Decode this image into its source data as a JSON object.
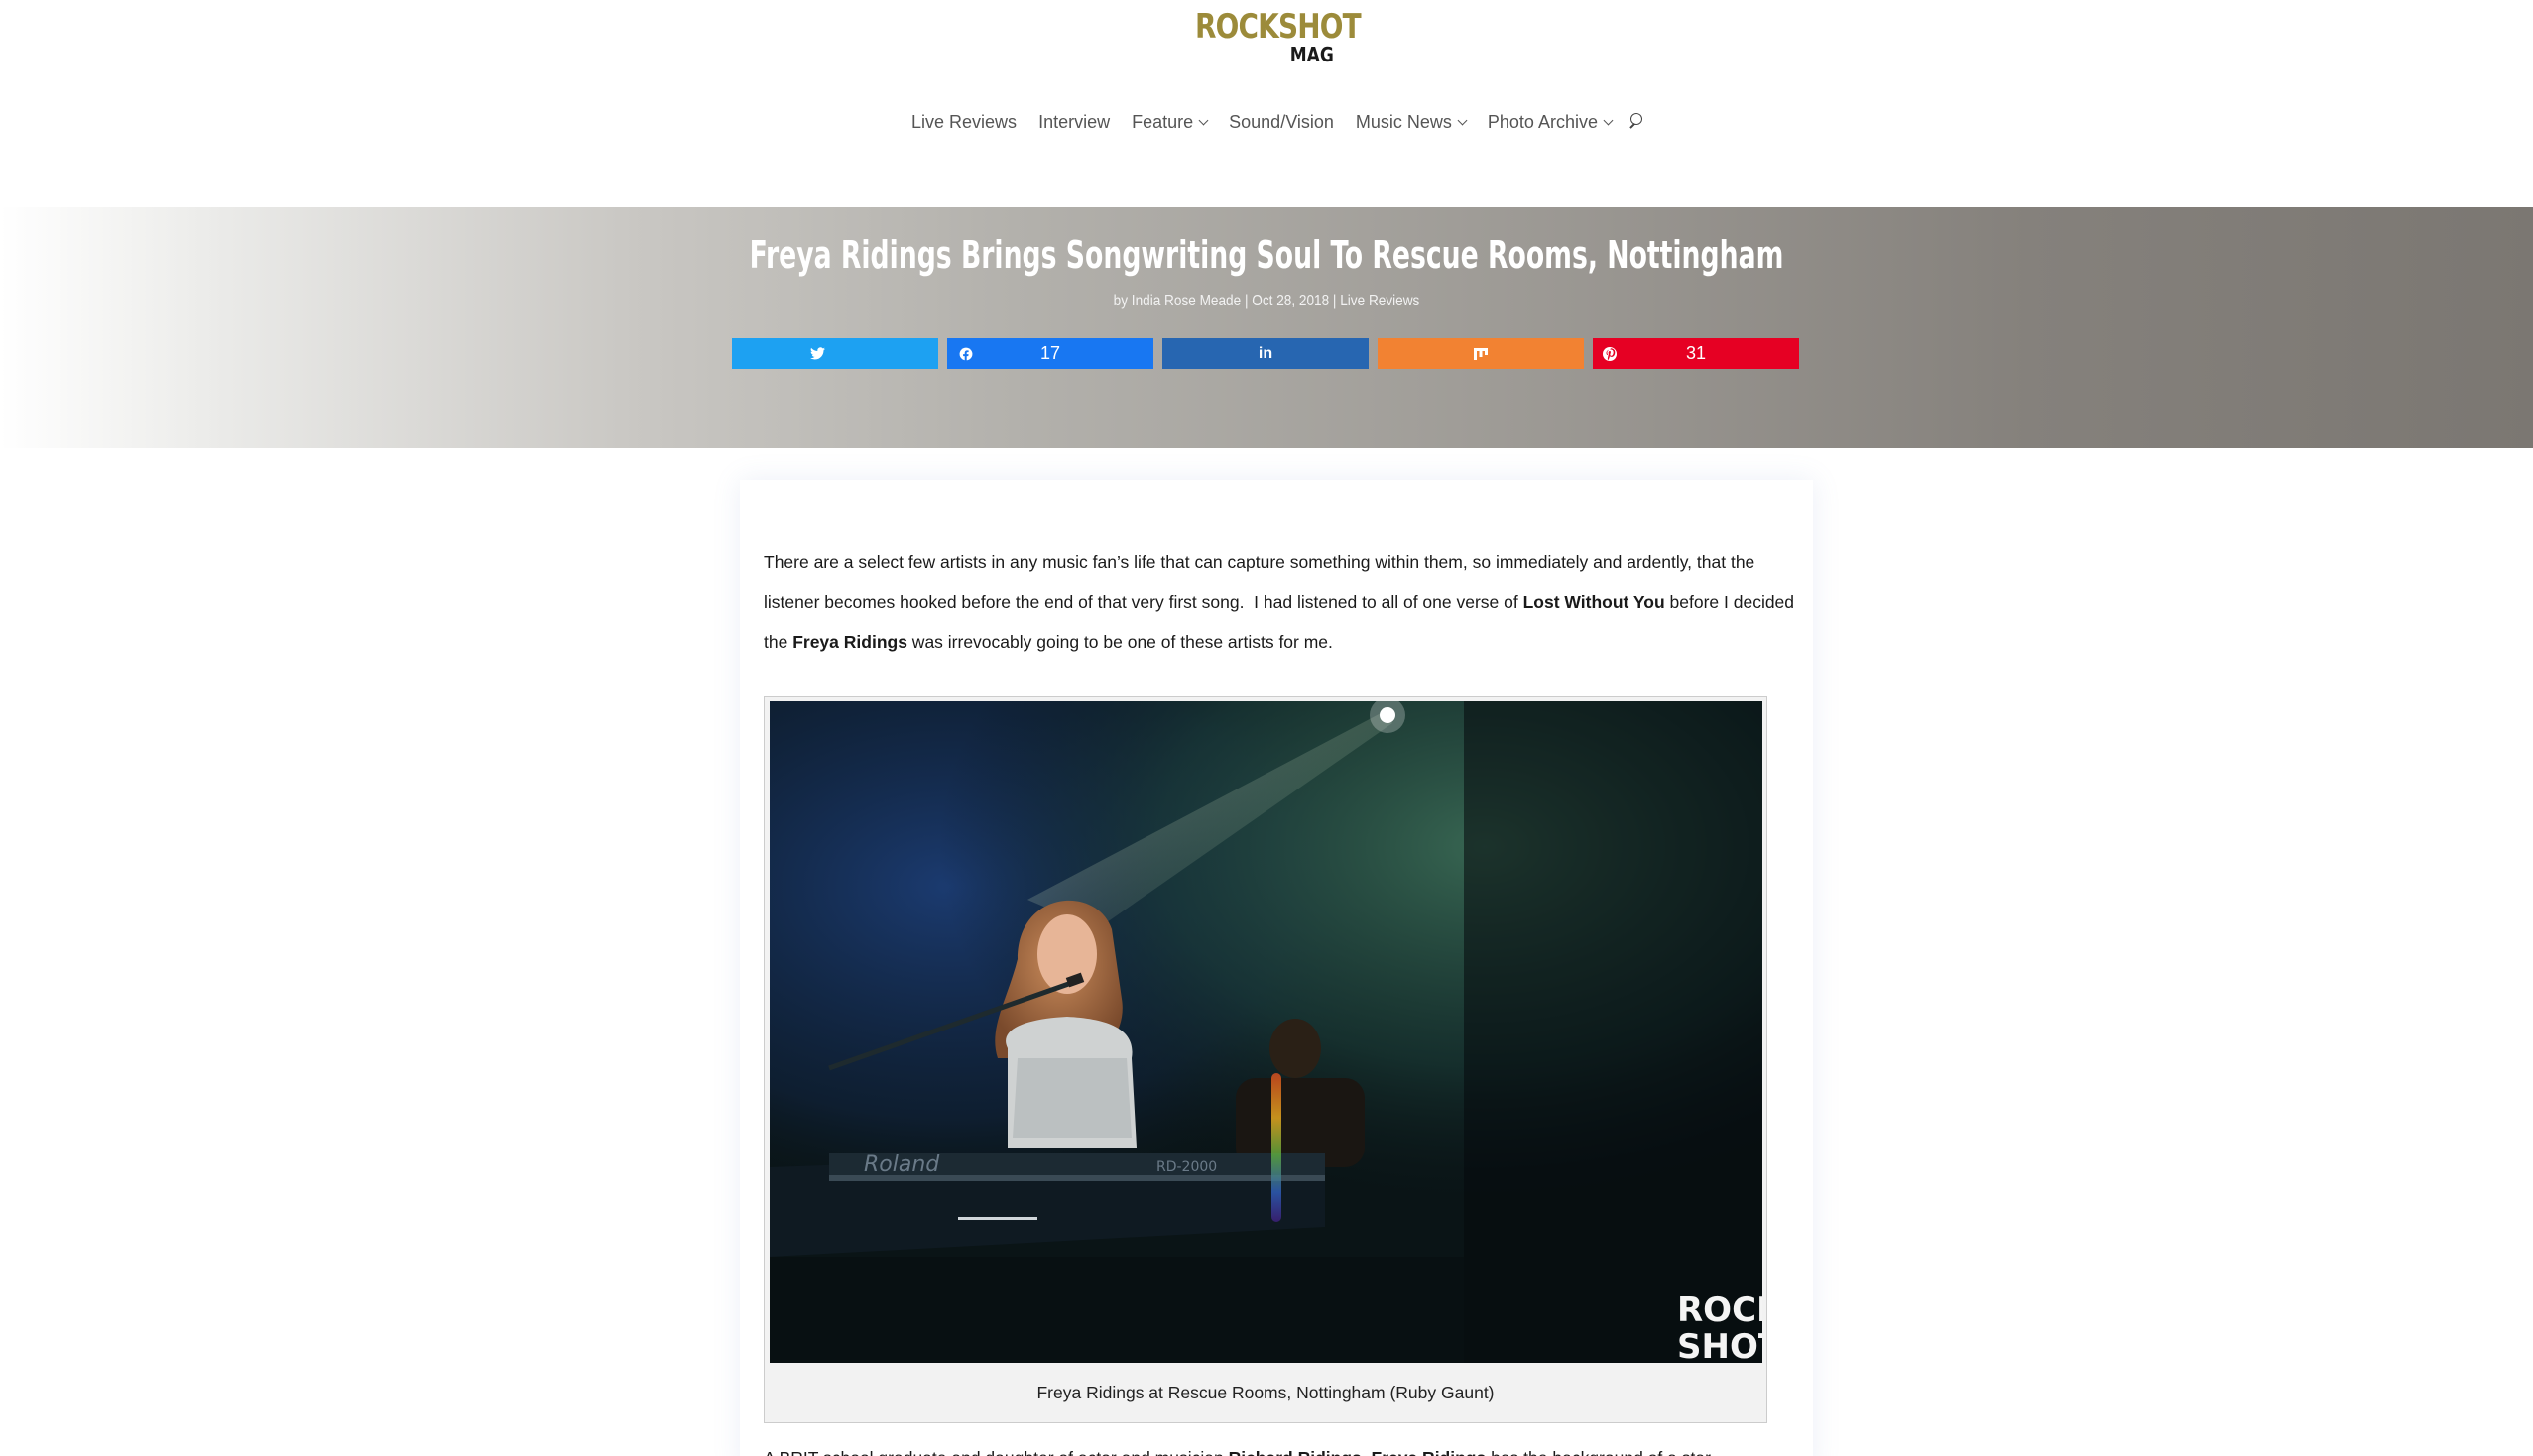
{
  "brand": {
    "logo_top": "ROCKSHOT",
    "logo_bottom": "MAG"
  },
  "nav": {
    "items": [
      {
        "label": "Live Reviews",
        "dropdown": false
      },
      {
        "label": "Interview",
        "dropdown": false
      },
      {
        "label": "Feature",
        "dropdown": true
      },
      {
        "label": "Sound/Vision",
        "dropdown": false
      },
      {
        "label": "Music News",
        "dropdown": true
      },
      {
        "label": "Photo Archive",
        "dropdown": true
      }
    ],
    "search_icon": "search-icon"
  },
  "post": {
    "title": "Freya Ridings Brings Songwriting Soul To Rescue Rooms, Nottingham",
    "meta": "by India Rose Meade | Oct 28, 2018 | Live Reviews"
  },
  "share": {
    "twitter": {
      "icon": "twitter-icon",
      "count": ""
    },
    "facebook": {
      "icon": "facebook-icon",
      "count": "17"
    },
    "linkedin": {
      "icon": "linkedin-icon",
      "count": ""
    },
    "mix": {
      "icon": "mix-icon",
      "count": ""
    },
    "pinterest": {
      "icon": "pinterest-icon",
      "count": "31"
    }
  },
  "article": {
    "p1_a": "There are a select few artists in any music fan’s life that can capture something within them, so immediately and ardently, that the listener becomes hooked before the end of that very first song.  I had listened to all of one verse of ",
    "p1_b": "Lost Without You",
    "p1_c": " before I decided the ",
    "p1_d": "Freya Ridings",
    "p1_e": " was irrevocably going to be one of these artists for me.",
    "photo_watermark_1": "ROCK",
    "photo_watermark_2": "SHOT",
    "keyboard_brand": "Roland",
    "keyboard_model": "RD-2000",
    "caption": "Freya Ridings at Rescue Rooms, Nottingham (Ruby Gaunt)",
    "p2_a": "A BRIT school graduate and daughter of actor and musician ",
    "p2_b": "Richard Ridings",
    "p2_c": ", ",
    "p2_d": "Freya Ridings",
    "p2_e": " has the background of a star"
  },
  "colors": {
    "logo_gold": "#9c8b3a",
    "twitter": "#1da1f2",
    "facebook": "#1877f2",
    "linkedin": "#2766b1",
    "mix": "#f28232",
    "pinterest": "#e60023"
  }
}
